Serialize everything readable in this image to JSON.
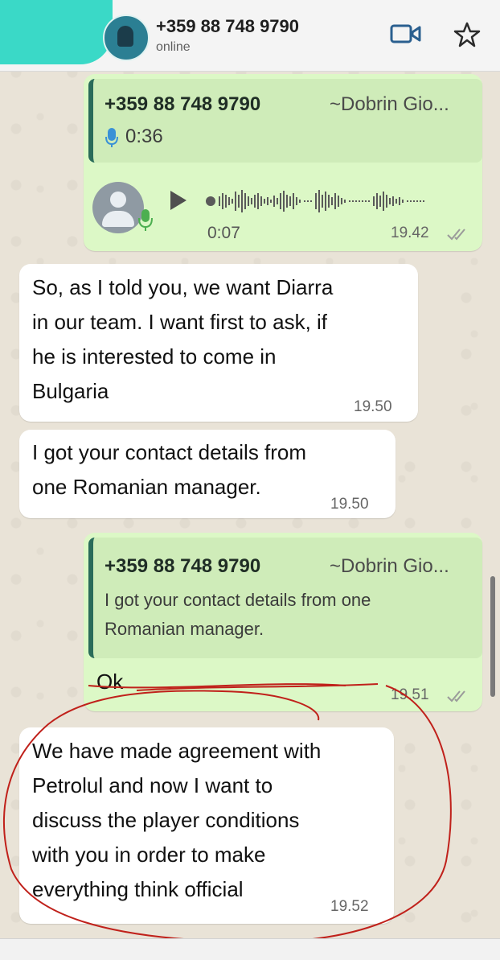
{
  "header": {
    "contact_name": "+359 88 748 9790",
    "status": "online",
    "video_icon": "video-call-icon",
    "star_icon": "star-icon"
  },
  "messages": {
    "voice_reply": {
      "quote_name": "+359 88 748 9790",
      "quote_author": "~Dobrin Gio...",
      "quote_duration": "0:36",
      "voice_duration": "0:07",
      "time": "19.42",
      "ticks": "✓✓"
    },
    "msg1": {
      "lines": [
        "So, as I told you, we want Diarra",
        "in our team. I want first to ask, if",
        "he is interested to come in",
        "Bulgaria"
      ],
      "time": "19.50"
    },
    "msg2": {
      "lines": [
        "I got your contact details from",
        "one Romanian manager."
      ],
      "time": "19.50"
    },
    "msg3": {
      "quote_name": "+359 88 748 9790",
      "quote_author": "~Dobrin Gio...",
      "quote_lines": [
        "I got your contact details from one",
        "Romanian manager."
      ],
      "text": "Ok",
      "time": "19.51",
      "ticks": "✓✓"
    },
    "msg4": {
      "lines": [
        "We have made agreement with",
        "Petrolul and now I want to",
        "discuss the player conditions",
        "with you in order to make",
        "everything think official"
      ],
      "time": "19.52"
    }
  },
  "colors": {
    "outgoing_bubble": "#dcf8c6",
    "incoming_bubble": "#ffffff",
    "annotation_red": "#c0211b"
  }
}
